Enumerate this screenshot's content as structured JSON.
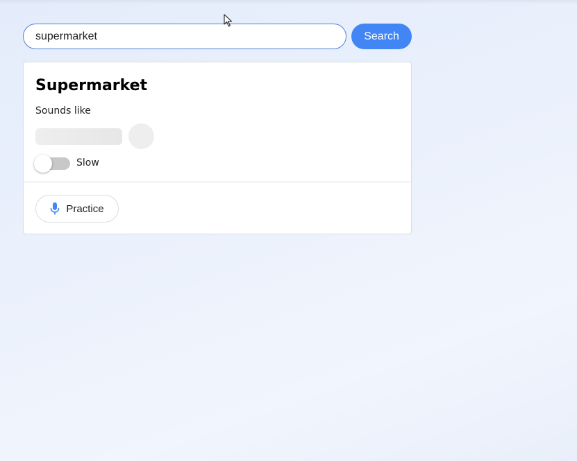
{
  "search": {
    "value": "supermarket",
    "button_label": "Search"
  },
  "card": {
    "word": "Supermarket",
    "sounds_like_label": "Sounds like",
    "slow_label": "Slow",
    "slow_enabled": false,
    "practice_label": "Practice"
  },
  "icons": {
    "mic": "mic-icon",
    "cursor": "mouse-pointer-icon"
  },
  "colors": {
    "accent": "#4285f4",
    "input_border": "#4f7fd6",
    "toggle_off": "#c8c8c8",
    "placeholder": "#eeeeee"
  }
}
